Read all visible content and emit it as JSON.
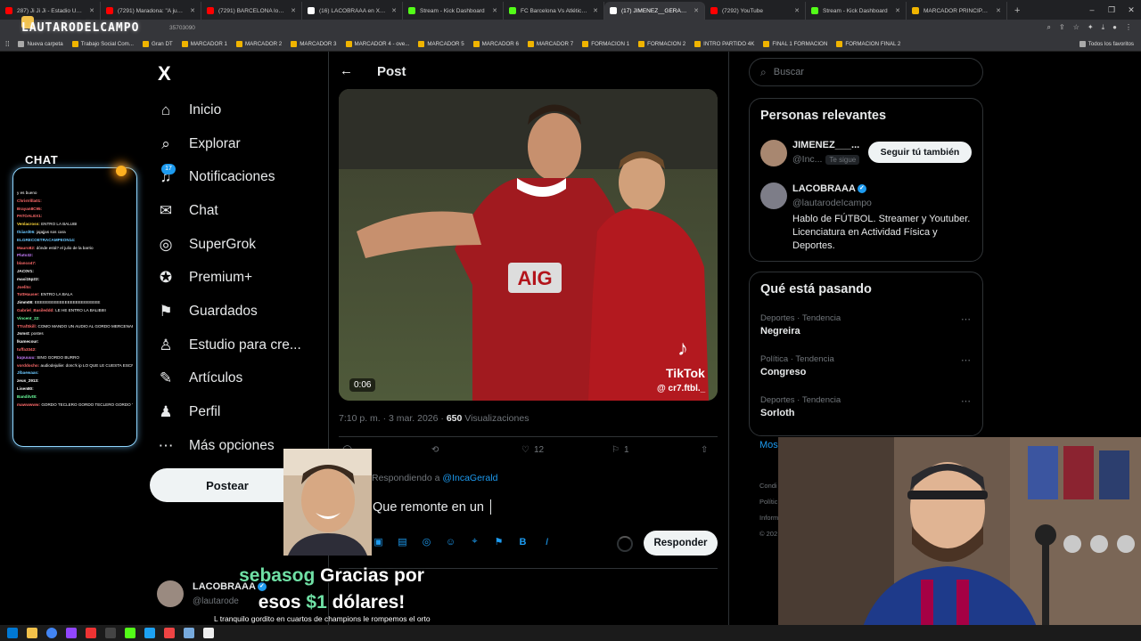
{
  "browser": {
    "tabs": [
      {
        "label": "287) Ji Ji Ji - Estadio Único de...",
        "color": "#ff0000"
      },
      {
        "label": "(7291) Maradona: \"A jugar\" a...",
        "color": "#ff0000"
      },
      {
        "label": "(7291) BARCELONA logró RE...",
        "color": "#ff0000"
      },
      {
        "label": "(16) LACOBRAAA en X: \"Barc...",
        "color": "#ffffff"
      },
      {
        "label": "Stream - Kick Dashboard",
        "color": "#53fc18"
      },
      {
        "label": "FC Barcelona Vs Atlético de M...",
        "color": "#53fc18"
      },
      {
        "label": "(17) JIMENEZ__GERALD en X:",
        "color": "#ffffff"
      },
      {
        "label": "(7292) YouTube",
        "color": "#ff0000"
      },
      {
        "label": "Stream - Kick Dashboard",
        "color": "#53fc18"
      },
      {
        "label": "MARCADOR PRINCIPAL - ove...",
        "color": "#f0b400"
      }
    ],
    "active_tab_index": 6,
    "new_tab": "+",
    "window_controls": [
      "–",
      "❐",
      "✕"
    ],
    "brand_overlay": "LAUTARODELCAMPO",
    "url_tail": "35703090",
    "bookmarks": [
      {
        "label": "Nueva carpeta",
        "folder": true
      },
      {
        "label": "Trabajo Social Com...",
        "folder": false
      },
      {
        "label": "Gran DT",
        "folder": false
      },
      {
        "label": "MARCADOR 1",
        "folder": false
      },
      {
        "label": "MARCADOR 2",
        "folder": false
      },
      {
        "label": "MARCADOR 3",
        "folder": false
      },
      {
        "label": "MARCADOR 4 - ove...",
        "folder": false
      },
      {
        "label": "MARCADOR 5",
        "folder": false
      },
      {
        "label": "MARCADOR 6",
        "folder": false
      },
      {
        "label": "MARCADOR 7",
        "folder": false
      },
      {
        "label": "FORMACION 1",
        "folder": false
      },
      {
        "label": "FORMACION 2",
        "folder": false
      },
      {
        "label": "INTRO PARTIDO 4K",
        "folder": false
      },
      {
        "label": "FINAL 1 FORMACION",
        "folder": false
      },
      {
        "label": "FORMACION FINAL 2",
        "folder": false
      }
    ],
    "all_bookmarks": "Todos los favoritos"
  },
  "chat": {
    "title": "CHAT",
    "lines": [
      {
        "user": "",
        "text": "y es bueno",
        "color": "#ffffff"
      },
      {
        "user": "ChrisVilla01:",
        "text": "",
        "color": "#ff6b6b"
      },
      {
        "user": "Brayan8C95:",
        "text": "",
        "color": "#ff6b6b"
      },
      {
        "user": "PATOALEX1:",
        "text": "",
        "color": "#ff6b6b"
      },
      {
        "user": "Venlacross:",
        "text": "ENTRO LA BALUBI",
        "color": "#ffd93b"
      },
      {
        "user": "thiiard06:",
        "text": "jajajjas sos cara",
        "color": "#6bc8ff"
      },
      {
        "user": "ELGRECOETRACAMPEON14:",
        "text": "",
        "color": "#6bc8ff"
      },
      {
        "user": "Mauro82:",
        "text": "dónde está? el julio de la barrio",
        "color": "#ff6b6b"
      },
      {
        "user": "Pluto32:",
        "text": "",
        "color": "#c77dff"
      },
      {
        "user": "blanco47:",
        "text": "",
        "color": "#ff6b6b"
      },
      {
        "user": "JAC0V1:",
        "text": "",
        "color": "#ffffff"
      },
      {
        "user": "maxi15p22:",
        "text": "",
        "color": "#ffffff"
      },
      {
        "user": "Joelito:",
        "text": "",
        "color": "#ff6b6b"
      },
      {
        "user": "TottHauser:",
        "text": "ENTRO LA BALA",
        "color": "#ff6b6b"
      },
      {
        "user": "Jimm08:",
        "text": "EEEEEEEEEEEEEEEEEEEEEEEE",
        "color": "#ffffff"
      },
      {
        "user": "Gabriel_Basileddd:",
        "text": "LE HE ENTRO LA BALIBIIII",
        "color": "#ff6b6b"
      },
      {
        "user": "Vincent_22:",
        "text": "",
        "color": "#6bff9e"
      },
      {
        "user": "TTrafSkill:",
        "text": "COMO MANDO UN AUDIO AL GORDO MERCENARIO",
        "color": "#ff6b6b"
      },
      {
        "user": "Jsmst:",
        "text": "postes",
        "color": "#ffffff"
      },
      {
        "user": "lkamecour:",
        "text": "",
        "color": "#ffffff"
      },
      {
        "user": "tuffa3342:",
        "text": "",
        "color": "#ff6b6b"
      },
      {
        "user": "kupuuuu:",
        "text": "SINO GORDO BURRO",
        "color": "#c77dff"
      },
      {
        "user": "vorddocho:",
        "text": "audiodejuliie: donc'k ip LO QUE LE CUESTA ESCRIBIR ESTAS GORDO GORDO",
        "color": "#ff6b6b"
      },
      {
        "user": "Jlbaewaas:",
        "text": "",
        "color": "#6bc8ff"
      },
      {
        "user": "zeus_2913:",
        "text": "",
        "color": "#ffffff"
      },
      {
        "user": "Lisen80:",
        "text": "",
        "color": "#ffffff"
      },
      {
        "user": "Banditvt8:",
        "text": "",
        "color": "#6bff9e"
      },
      {
        "user": "mawwwww:",
        "text": "GORDO TECLERO GORDO TECLERO GORDO TECLERO GORDO TECLERO GORDO TECLERO GORDO TECLERO GORDO TECLERO",
        "color": "#ff6b6b"
      }
    ]
  },
  "x_nav": {
    "logo": "X",
    "items": [
      {
        "label": "Inicio",
        "icon": "home-icon",
        "glyph": "⌂"
      },
      {
        "label": "Explorar",
        "icon": "search-icon",
        "glyph": "⌕"
      },
      {
        "label": "Notificaciones",
        "icon": "bell-icon",
        "glyph": "♫"
      },
      {
        "label": "Chat",
        "icon": "mail-icon",
        "glyph": "✉"
      },
      {
        "label": "SuperGrok",
        "icon": "grok-icon",
        "glyph": "◎"
      },
      {
        "label": "Premium+",
        "icon": "premium-icon",
        "glyph": "✪"
      },
      {
        "label": "Guardados",
        "icon": "bookmark-icon",
        "glyph": "⚑"
      },
      {
        "label": "Estudio para cre...",
        "icon": "studio-icon",
        "glyph": "♙"
      },
      {
        "label": "Artículos",
        "icon": "article-icon",
        "glyph": "✎"
      },
      {
        "label": "Perfil",
        "icon": "profile-icon",
        "glyph": "♟"
      },
      {
        "label": "Más opciones",
        "icon": "more-icon",
        "glyph": "⋯"
      }
    ],
    "notif_count": "17",
    "post_button": "Postear",
    "account": {
      "name": "LACOBRAAA",
      "handle": "@lautarode"
    }
  },
  "post": {
    "header": "Post",
    "video_time": "0:06",
    "tiktok_label": "TikTok",
    "tiktok_handle": "@ cr7.ftbl._",
    "jersey_sponsor": "AIG",
    "time": "7:10 p. m. · 3 mar. 2026 · ",
    "views": "650",
    "views_label": " Visualizaciones",
    "likes": "12",
    "bookmarks": "1",
    "replying_prefix": "Respondiendo a ",
    "replying_to": "@IncaGerald",
    "reply_value": "Que remonte en un",
    "reply_button": "Responder"
  },
  "right": {
    "search_placeholder": "Buscar",
    "relevant_title": "Personas relevantes",
    "people": [
      {
        "name": "JIMENEZ___...",
        "handle": "@Inc...",
        "follows_you": "Te sigue",
        "button": "Seguir tú también"
      },
      {
        "name": "LACOBRAAA",
        "handle": "@lautarodeIcampo",
        "bio": "Hablo de FÚTBOL. Streamer y Youtuber. Licenciatura en Actividad Física y Deportes."
      }
    ],
    "trending_title": "Qué está pasando",
    "trends": [
      {
        "category": "Deportes · Tendencia",
        "name": "Negreira"
      },
      {
        "category": "Política · Tendencia",
        "name": "Congreso"
      },
      {
        "category": "Deportes · Tendencia",
        "name": "Sorloth"
      }
    ],
    "show_more": "Mos",
    "footer": [
      "Condi",
      "Polític",
      "Inform",
      "© 202"
    ]
  },
  "overlay": {
    "donor": "sebasog",
    "thanks": " Gracias por",
    "amount_prefix": "esos ",
    "amount": "$1",
    "amount_suffix": " dólares!",
    "message": "L tranquilo gordito en cuartos de champions le rompemos el orto"
  },
  "colors": {
    "accent": "#1d9bf0",
    "bg": "#000000",
    "border": "#2f3336",
    "muted": "#71767b"
  }
}
